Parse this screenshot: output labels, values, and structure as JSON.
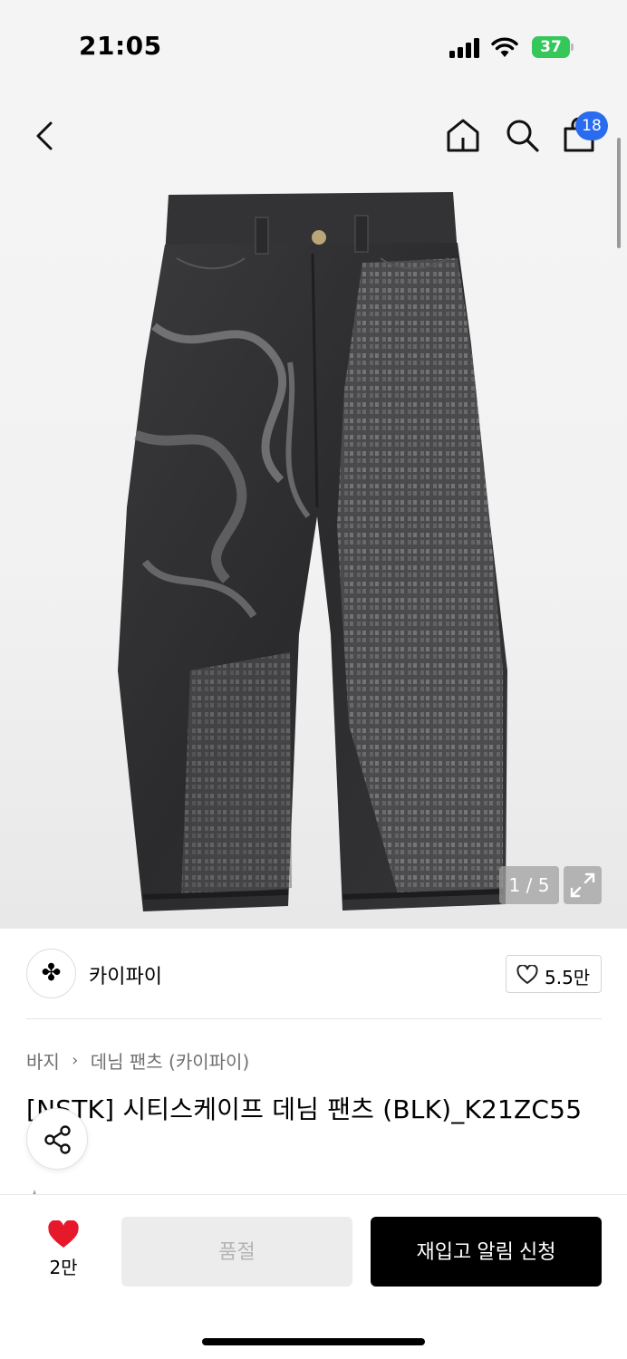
{
  "status": {
    "time": "21:05",
    "battery": "37"
  },
  "nav": {
    "cart_count": "18",
    "icons": [
      "back-icon",
      "home-icon",
      "search-icon",
      "cart-icon"
    ]
  },
  "gallery": {
    "counter": "1 / 5"
  },
  "brand": {
    "name": "카이파이",
    "logo": "✤",
    "like_count": "5.5만"
  },
  "breadcrumb": {
    "category": "바지",
    "sub": "데님 팬츠 (카이파이)"
  },
  "product": {
    "title": "[NSTK] 시티스케이프 데님 팬츠 (BLK)_K21ZC55"
  },
  "actions": {
    "wish_count": "2만",
    "soldout_label": "품절",
    "restock_label": "재입고 알림 신청"
  },
  "colors": {
    "accent_blue": "#2a6cf0",
    "battery_green": "#34c759",
    "heart_red": "#e6192b"
  }
}
